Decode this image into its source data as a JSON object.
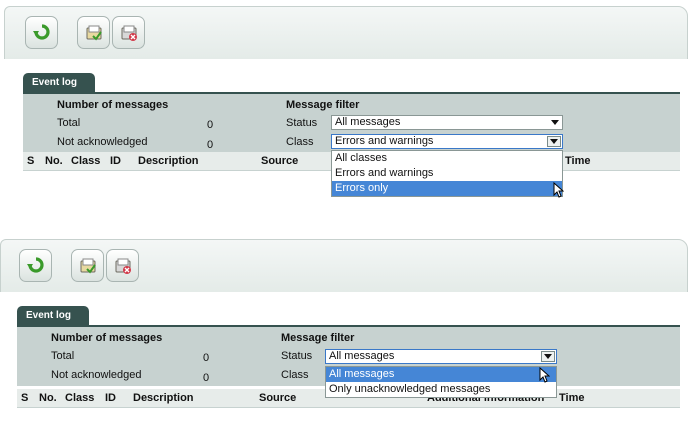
{
  "panel_top": {
    "tab_label": "Event log",
    "counts_heading": "Number of messages",
    "total_label": "Total",
    "total_value": "0",
    "unack_label": "Not acknowledged",
    "unack_value": "0",
    "filter_heading": "Message filter",
    "status_label": "Status",
    "status_value": "All messages",
    "class_label": "Class",
    "class_value": "Errors and warnings",
    "class_options": [
      "All classes",
      "Errors and warnings",
      "Errors only"
    ],
    "class_highlighted": "Errors only",
    "columns": [
      "S",
      "No.",
      "Class",
      "ID",
      "Description",
      "Source",
      "Time"
    ]
  },
  "panel_bottom": {
    "tab_label": "Event log",
    "counts_heading": "Number of messages",
    "total_label": "Total",
    "total_value": "0",
    "unack_label": "Not acknowledged",
    "unack_value": "0",
    "filter_heading": "Message filter",
    "status_label": "Status",
    "status_value": "All messages",
    "status_options": [
      "All messages",
      "Only unacknowledged messages"
    ],
    "status_highlighted": "All messages",
    "class_label": "Class",
    "columns": [
      "S",
      "No.",
      "Class",
      "ID",
      "Description",
      "Source",
      "Additional information",
      "Time"
    ]
  },
  "toolbar": {
    "refresh_icon": "refresh-icon",
    "acknowledge_icon": "acknowledge-folder-icon",
    "delete_icon": "delete-folder-icon"
  }
}
